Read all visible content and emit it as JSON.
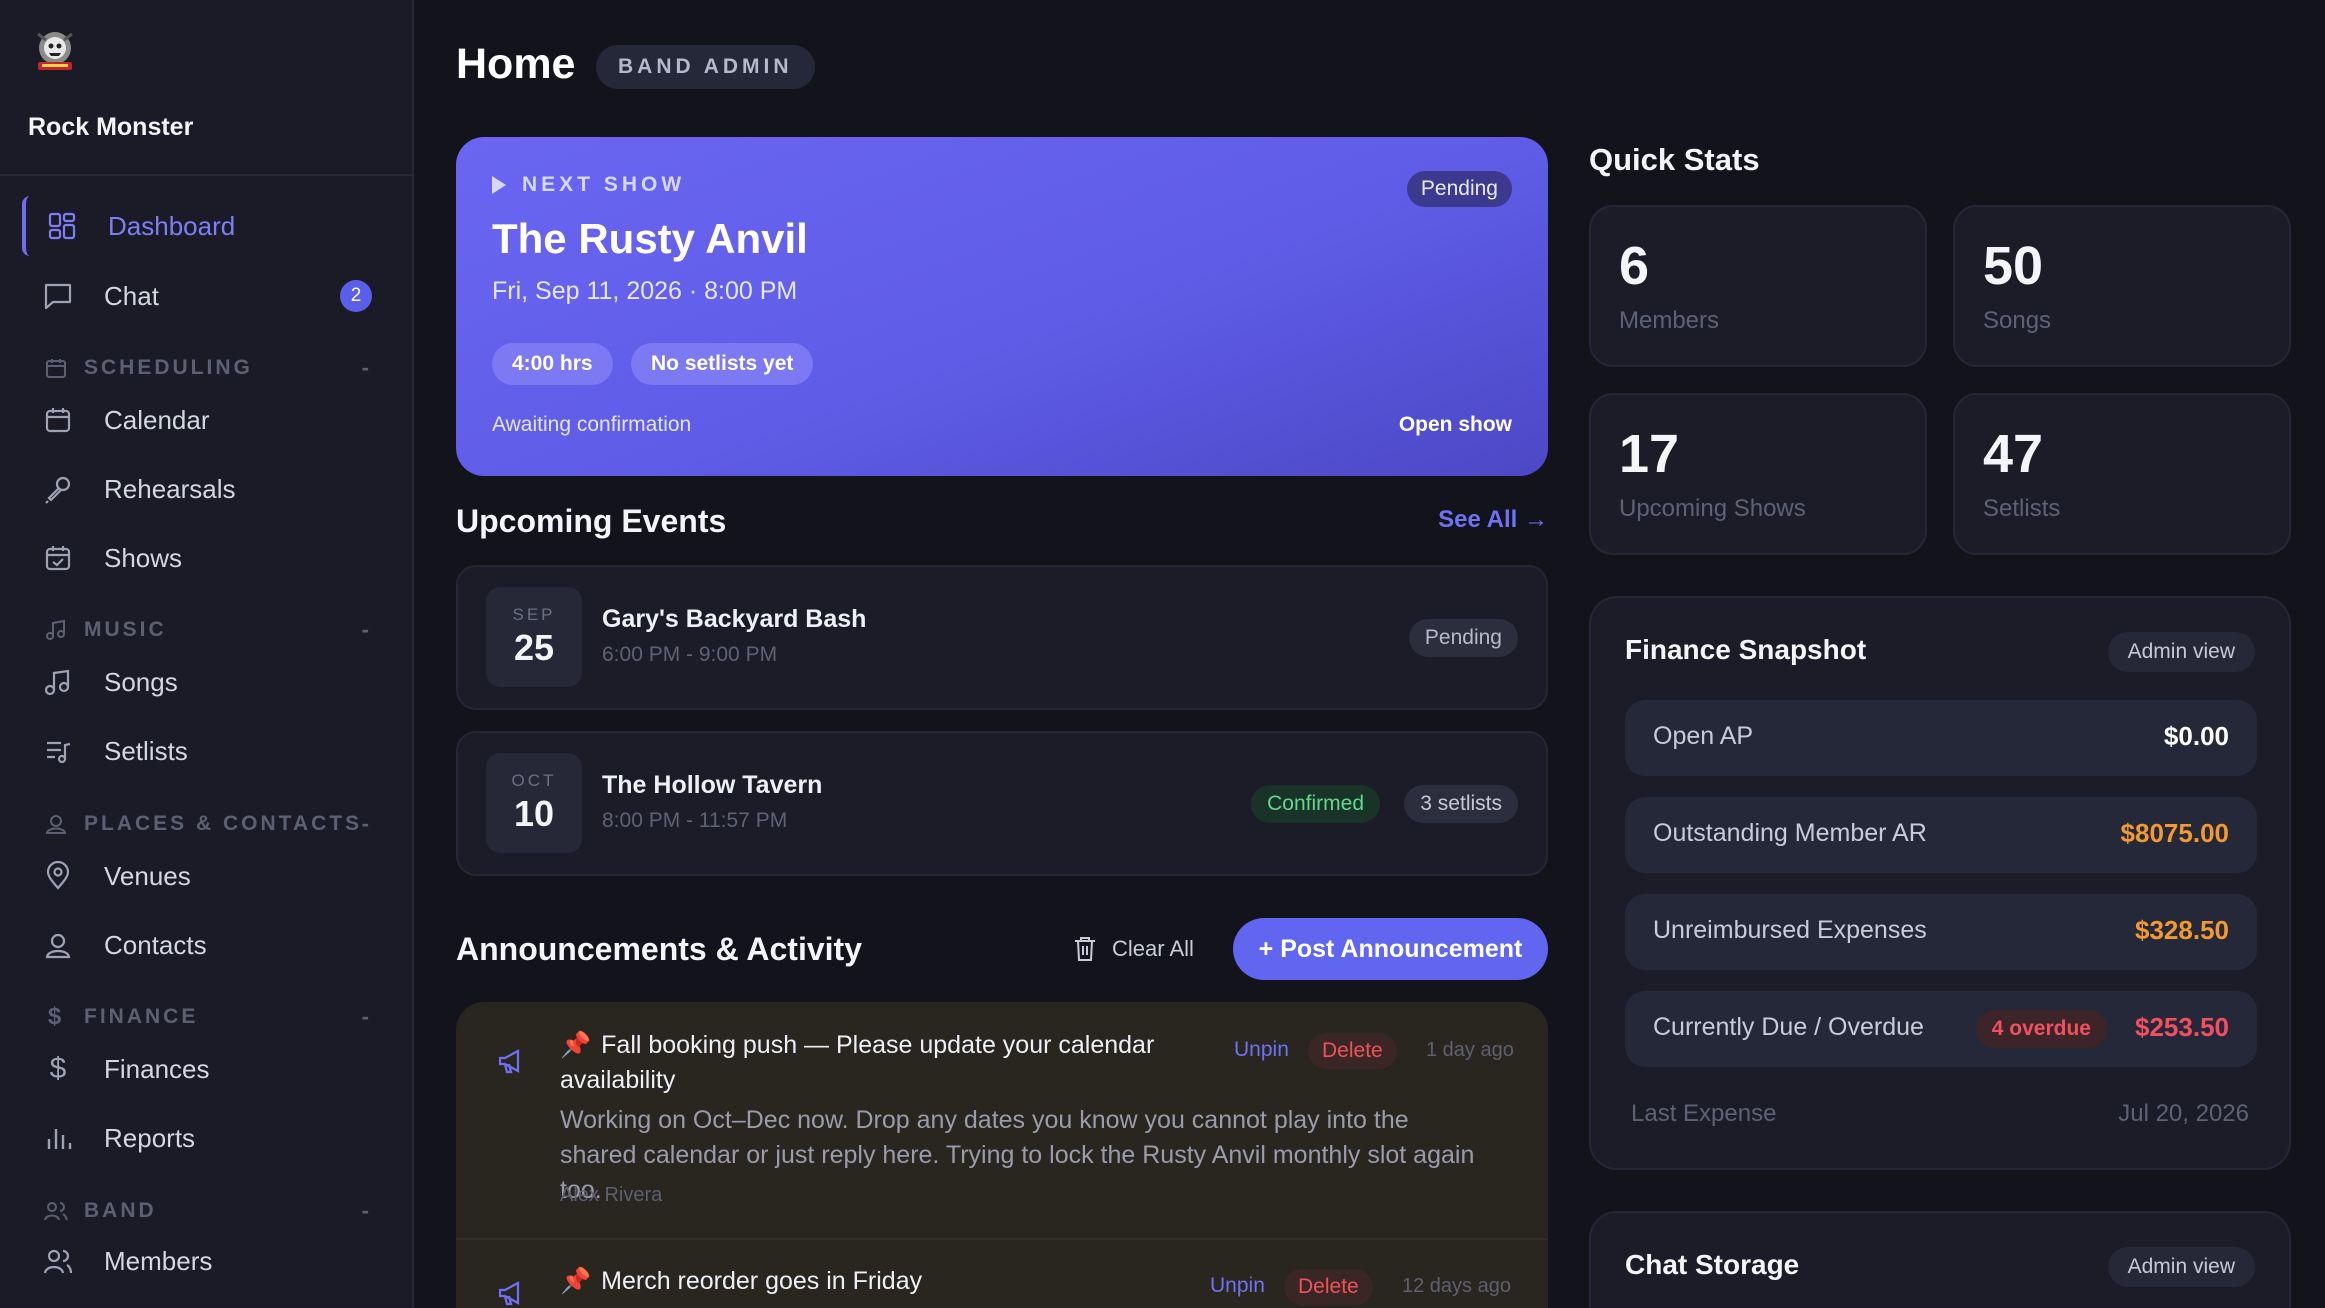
{
  "app": {
    "band_name": "Rock Monster"
  },
  "nav": {
    "dashboard": "Dashboard",
    "chat": "Chat",
    "chat_badge": "2",
    "sections": {
      "scheduling": "SCHEDULING",
      "music": "MUSIC",
      "places": "PLACES & CONTACTS",
      "finance": "FINANCE",
      "band": "BAND"
    },
    "collapse_symbol": "-",
    "calendar": "Calendar",
    "rehearsals": "Rehearsals",
    "shows": "Shows",
    "songs": "Songs",
    "setlists": "Setlists",
    "venues": "Venues",
    "contacts": "Contacts",
    "finances": "Finances",
    "reports": "Reports",
    "members": "Members"
  },
  "header": {
    "title": "Home",
    "role": "BAND ADMIN"
  },
  "next_show": {
    "eyebrow": "NEXT SHOW",
    "status": "Pending",
    "title": "The Rusty Anvil",
    "date": "Fri, Sep 11, 2026 · 8:00 PM",
    "chips": [
      "4:00 hrs",
      "No setlists yet"
    ],
    "footer": "Awaiting confirmation",
    "open_label": "Open show"
  },
  "upcoming": {
    "title": "Upcoming Events",
    "see_all": "See All →",
    "events": [
      {
        "month": "SEP",
        "day": "25",
        "name": "Gary's Backyard Bash",
        "time": "6:00 PM - 9:00 PM",
        "status": "Pending"
      },
      {
        "month": "OCT",
        "day": "10",
        "name": "The Hollow Tavern",
        "time": "8:00 PM - 11:57 PM",
        "status": "Confirmed",
        "extra": "3 setlists"
      }
    ]
  },
  "announcements": {
    "title": "Announcements & Activity",
    "clear_all": "Clear All",
    "post_button": "+ Post Announcement",
    "items": [
      {
        "pin": "📌",
        "title": "Fall booking push — Please update your calendar availability",
        "body": "Working on Oct–Dec now. Drop any dates you know you cannot play into the shared calendar or just reply here. Trying to lock the Rusty Anvil monthly slot again too.",
        "author": "Alex Rivera",
        "unpin": "Unpin",
        "delete": "Delete",
        "ago": "1 day ago"
      },
      {
        "pin": "📌",
        "title": "Merch reorder goes in Friday",
        "unpin": "Unpin",
        "delete": "Delete",
        "ago": "12 days ago"
      }
    ]
  },
  "quick_stats": {
    "title": "Quick Stats",
    "stats": [
      {
        "value": "6",
        "label": "Members"
      },
      {
        "value": "50",
        "label": "Songs"
      },
      {
        "value": "17",
        "label": "Upcoming Shows"
      },
      {
        "value": "47",
        "label": "Setlists"
      }
    ]
  },
  "finance": {
    "title": "Finance Snapshot",
    "admin_label": "Admin view",
    "rows": [
      {
        "label": "Open AP",
        "value": "$0.00"
      },
      {
        "label": "Outstanding Member AR",
        "value": "$8075.00"
      },
      {
        "label": "Unreimbursed Expenses",
        "value": "$328.50"
      },
      {
        "label": "Currently Due / Overdue",
        "value": "$253.50",
        "badge": "4 overdue"
      }
    ],
    "last_label": "Last Expense",
    "last_value": "Jul 20, 2026"
  },
  "chat_storage": {
    "title": "Chat Storage",
    "admin_label": "Admin view"
  },
  "colors": {
    "accent": "#6166f0",
    "hero": "#5f5ce7",
    "warning": "#f29a2e",
    "danger": "#f05060",
    "success": "#5fd98e"
  }
}
